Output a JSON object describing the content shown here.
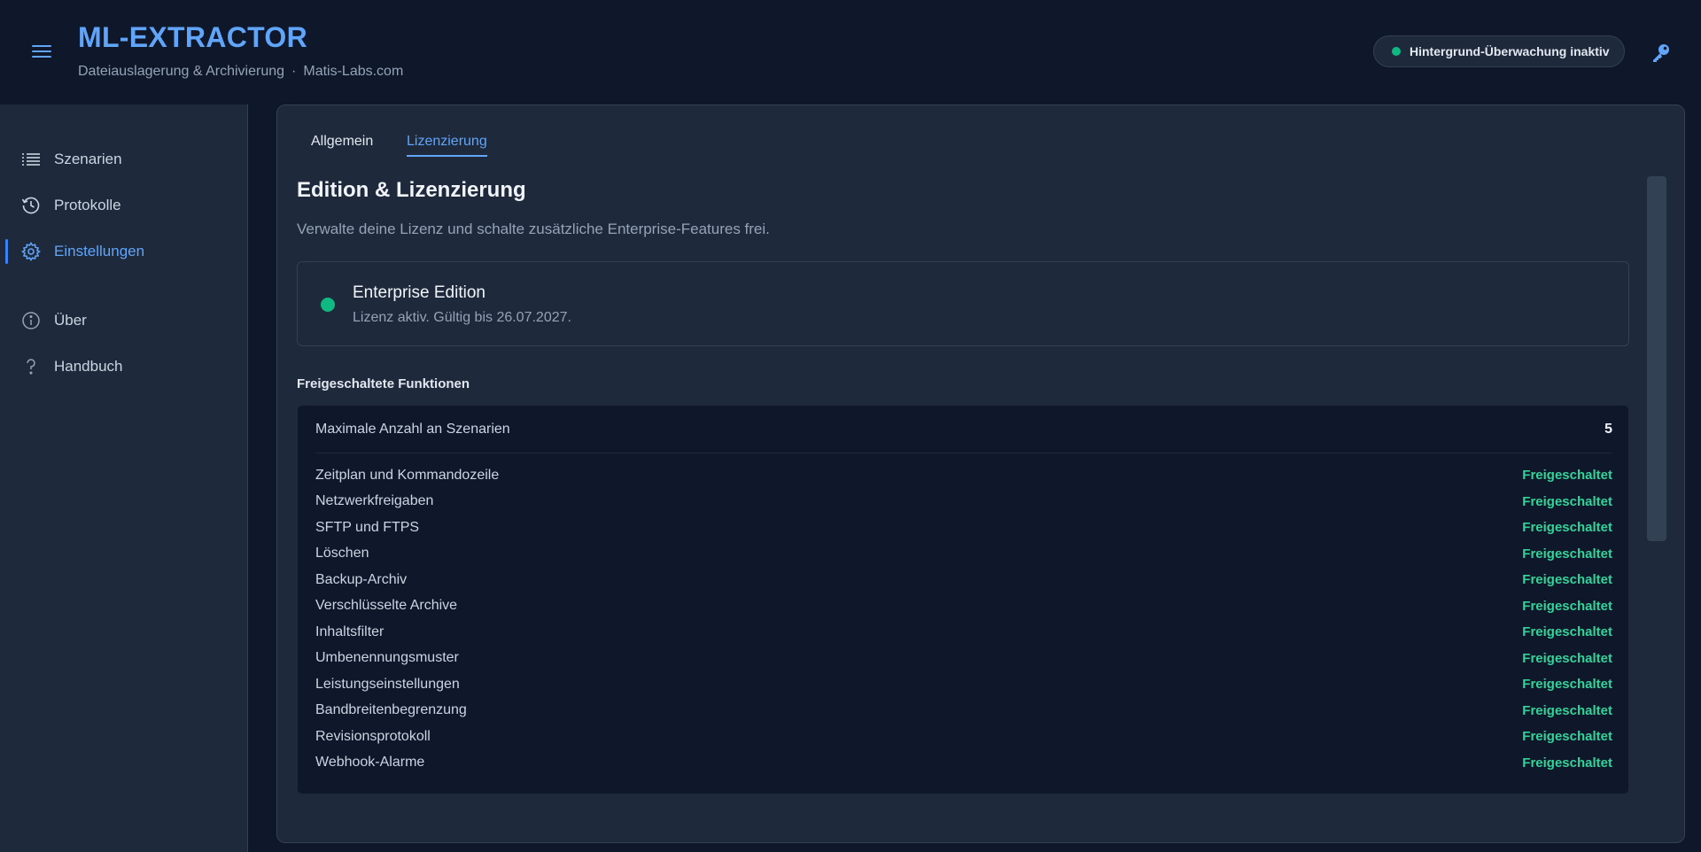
{
  "header": {
    "title": "ML-EXTRACTOR",
    "subtitle": "Dateiauslagerung & Archivierung",
    "separator": "·",
    "website": "Matis-Labs.com",
    "status_label": "Hintergrund-Überwachung inaktiv",
    "status_color": "#10b981",
    "menu_icon": "hamburger-icon",
    "license_icon": "key-icon"
  },
  "sidebar": {
    "items": [
      {
        "label": "Szenarien",
        "icon": "list-icon",
        "active": false
      },
      {
        "label": "Protokolle",
        "icon": "history-icon",
        "active": false
      },
      {
        "label": "Einstellungen",
        "icon": "gear-icon",
        "active": true
      },
      {
        "label": "Über",
        "icon": "info-icon",
        "active": false
      },
      {
        "label": "Handbuch",
        "icon": "question-icon",
        "active": false
      }
    ]
  },
  "tabs": [
    {
      "label": "Allgemein",
      "active": false
    },
    {
      "label": "Lizenzierung",
      "active": true
    }
  ],
  "license": {
    "title": "Edition & Lizenzierung",
    "description": "Verwalte deine Lizenz und schalte zusätzliche Enterprise-Features frei.",
    "edition_name": "Enterprise Edition",
    "validity": "Lizenz aktiv. Gültig bis 26.07.2027.",
    "status_color": "#10b981"
  },
  "features": {
    "heading": "Freigeschaltete Funktionen",
    "max_scenarios_label": "Maximale Anzahl an Szenarien",
    "max_scenarios_value": "5",
    "items": [
      {
        "name": "Zeitplan und Kommandozeile",
        "state": "Freigeschaltet"
      },
      {
        "name": "Netzwerkfreigaben",
        "state": "Freigeschaltet"
      },
      {
        "name": "SFTP und FTPS",
        "state": "Freigeschaltet"
      },
      {
        "name": "Löschen",
        "state": "Freigeschaltet"
      },
      {
        "name": "Backup-Archiv",
        "state": "Freigeschaltet"
      },
      {
        "name": "Verschlüsselte Archive",
        "state": "Freigeschaltet"
      },
      {
        "name": "Inhaltsfilter",
        "state": "Freigeschaltet"
      },
      {
        "name": "Umbenennungsmuster",
        "state": "Freigeschaltet"
      },
      {
        "name": "Leistungseinstellungen",
        "state": "Freigeschaltet"
      },
      {
        "name": "Bandbreitenbegrenzung",
        "state": "Freigeschaltet"
      },
      {
        "name": "Revisionsprotokoll",
        "state": "Freigeschaltet"
      },
      {
        "name": "Webhook-Alarme",
        "state": "Freigeschaltet"
      }
    ]
  },
  "colors": {
    "accent": "#60a5fa",
    "success": "#34d399",
    "background": "#0f172a",
    "panel": "#1e293b"
  }
}
